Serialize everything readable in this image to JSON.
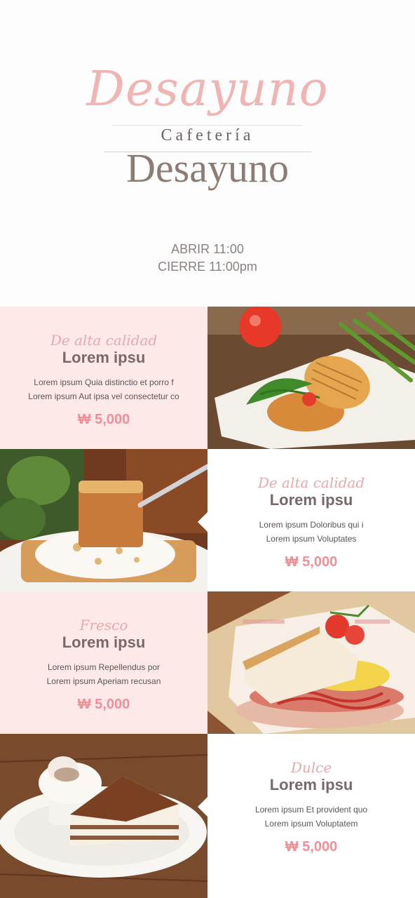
{
  "header": {
    "logo_script": "Desayuno",
    "logo_sub": "Cafetería",
    "logo_main": "Desayuno",
    "hours_open": "ABRIR 11:00",
    "hours_close": "CIERRE 11:00pm"
  },
  "items": [
    {
      "tagline": "De alta calidad",
      "title": "Lorem ipsu",
      "desc_line1": "Lorem ipsum Quia distinctio et porro f",
      "desc_line2": "Lorem ipsum Aut ipsa vel consectetur co",
      "price": "₩ 5,000",
      "photo": "toast-sandwich-tomato-photo"
    },
    {
      "tagline": "De alta calidad",
      "title": "Lorem ipsu",
      "desc_line1": "Lorem ipsum Doloribus qui i",
      "desc_line2": "Lorem ipsum Voluptates",
      "price": "₩ 5,000",
      "photo": "french-toast-cream-fork-photo"
    },
    {
      "tagline": "Fresco",
      "title": "Lorem ipsu",
      "desc_line1": "Lorem ipsum Repellendus por",
      "desc_line2": "Lorem ipsum Aperiam recusan",
      "price": "₩ 5,000",
      "photo": "bacon-egg-sandwich-photo"
    },
    {
      "tagline": "Dulce",
      "title": "Lorem ipsu",
      "desc_line1": "Lorem ipsum Et provident quo",
      "desc_line2": "Lorem ipsum Voluptatem",
      "price": "₩ 5,000",
      "photo": "tiramisu-cake-photo"
    }
  ],
  "colors": {
    "accent_pink": "#ef8f98",
    "panel_pink": "#fde9e8",
    "title_brown": "#78686a"
  }
}
